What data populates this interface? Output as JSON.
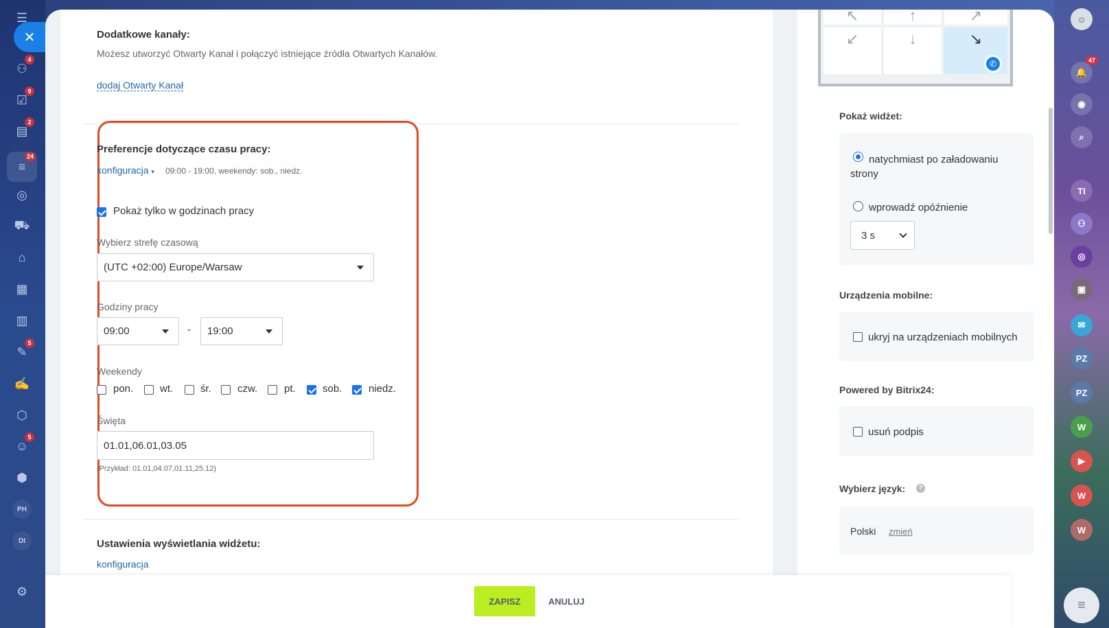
{
  "left_sidebar": {
    "close_icon": "close-icon",
    "items": [
      {
        "icon": "menu-icon",
        "badge": ""
      },
      {
        "icon": "crm-icon",
        "badge": "4"
      },
      {
        "icon": "tasks-icon",
        "badge": "9"
      },
      {
        "icon": "feed-icon",
        "badge": "2"
      },
      {
        "icon": "contact-center-icon",
        "badge": "24"
      },
      {
        "icon": "target-icon",
        "badge": ""
      },
      {
        "icon": "cart-icon",
        "badge": ""
      },
      {
        "icon": "store-icon",
        "badge": ""
      },
      {
        "icon": "calendar-icon",
        "badge": ""
      },
      {
        "icon": "analytics-icon",
        "badge": ""
      },
      {
        "icon": "forms-icon",
        "badge": "5"
      },
      {
        "icon": "sign-icon",
        "badge": ""
      },
      {
        "icon": "hexagon-icon",
        "badge": ""
      },
      {
        "icon": "robot-icon",
        "badge": "5"
      },
      {
        "icon": "box-icon",
        "badge": ""
      }
    ],
    "avatars": [
      "PH",
      "DI"
    ]
  },
  "right_sidebar": {
    "notifications_badge": "47",
    "avatars": [
      "TI",
      "PZ",
      "PZ",
      "W",
      "W",
      "W"
    ]
  },
  "additional_channels": {
    "title": "Dodatkowe kanały:",
    "description": "Możesz utworzyć Otwarty Kanał i połączyć istniejące źródła Otwartych Kanałów.",
    "add_link": "dodaj Otwarty Kanał"
  },
  "working_time": {
    "title": "Preferencje dotyczące czasu pracy:",
    "config_link": "konfiguracja",
    "summary": "09:00 - 19:00, weekendy: sob., niedz.",
    "only_working_hours_label": "Pokaż tylko w godzinach pracy",
    "only_working_hours_checked": true,
    "timezone_label": "Wybierz strefę czasową",
    "timezone_value": "(UTC +02:00) Europe/Warsaw",
    "hours_label": "Godziny pracy",
    "hours_from": "09:00",
    "hours_dash": "-",
    "hours_to": "19:00",
    "weekends_label": "Weekendy",
    "days": [
      {
        "label": "pon.",
        "checked": false
      },
      {
        "label": "wt.",
        "checked": false
      },
      {
        "label": "śr.",
        "checked": false
      },
      {
        "label": "czw.",
        "checked": false
      },
      {
        "label": "pt.",
        "checked": false
      },
      {
        "label": "sob.",
        "checked": true
      },
      {
        "label": "niedz.",
        "checked": true
      }
    ],
    "holidays_label": "Święta",
    "holidays_value": "01.01,06.01,03.05",
    "holidays_example": "(Przykład: 01.01,04.07,01.11,25.12)"
  },
  "display_settings": {
    "title": "Ustawienia wyświetlania widżetu:",
    "config_link": "konfiguracja"
  },
  "side": {
    "show_widget_title": "Pokaż widżet:",
    "radio_immediately": "natychmiast po załadowaniu strony",
    "radio_delay": "wprowadź opóźnienie",
    "delay_value": "3 s",
    "mobile_title": "Urządzenia mobilne:",
    "mobile_hide_label": "ukryj na urządzeniach mobilnych",
    "powered_title": "Powered by Bitrix24:",
    "remove_signature_label": "usuń podpis",
    "language_title": "Wybierz język:",
    "language_value": "Polski",
    "language_change": "zmień"
  },
  "footer": {
    "save_label": "ZAPISZ",
    "cancel_label": "ANULUJ"
  },
  "colors": {
    "accent": "#1a73e8",
    "link": "#2067b0",
    "highlight": "#e04a1f",
    "save_button": "#bbed21"
  }
}
